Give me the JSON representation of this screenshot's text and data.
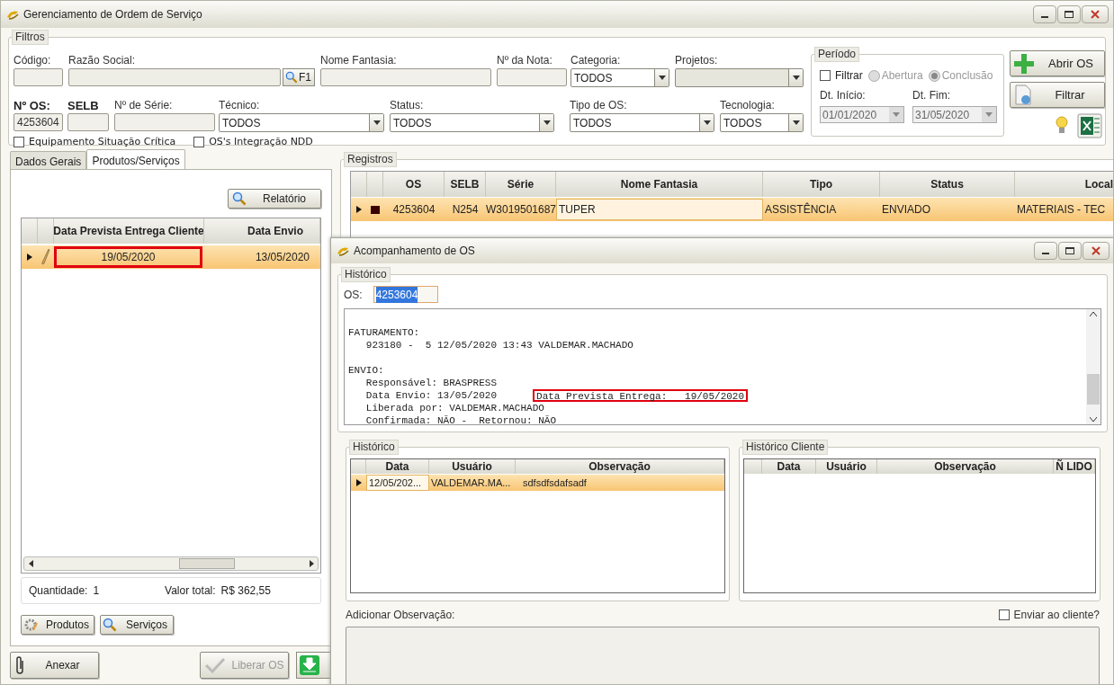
{
  "window": {
    "title": "Gerenciamento de Ordem de Serviço"
  },
  "filters": {
    "title": "Filtros",
    "row_1": [
      {
        "kind": "text",
        "label": "Código:"
      },
      {
        "kind": "lookup",
        "label": "Razão Social:",
        "button": "F1"
      },
      {
        "kind": "text",
        "label": "Nome Fantasia:"
      },
      {
        "kind": "text",
        "label": "Nº da Nota:"
      },
      {
        "kind": "combo",
        "label": "Categoria:",
        "value": "TODOS"
      },
      {
        "kind": "combo",
        "label": "Projetos:",
        "disabled": true
      }
    ],
    "row_2": [
      {
        "kind": "text",
        "label": "Nº OS:",
        "emphasized": true,
        "value": "4253604"
      },
      {
        "kind": "text",
        "label": "SELB",
        "emphasized": true
      },
      {
        "kind": "text",
        "label": "Nº de Série:"
      },
      {
        "kind": "combo",
        "label": "Técnico:",
        "value": "TODOS"
      },
      {
        "kind": "combo",
        "label": "Status:",
        "value": "TODOS"
      },
      {
        "kind": "combo",
        "label": "Tipo de OS:",
        "value": "TODOS"
      },
      {
        "kind": "combo",
        "label": "Tecnologia:",
        "value": "TODOS"
      }
    ],
    "checkboxes": [
      {
        "label": "Equipamento Situação Crítica",
        "checked": false
      },
      {
        "label": "OS's Integração NDD",
        "checked": false
      }
    ],
    "period": {
      "title": "Período",
      "filter": {
        "label": "Filtrar",
        "checked": false
      },
      "radios": [
        {
          "label": "Abertura",
          "selected": false,
          "disabled": true
        },
        {
          "label": "Conclusão",
          "selected": true,
          "disabled": true
        }
      ],
      "start": {
        "label": "Dt. Início:",
        "value": "01/01/2020"
      },
      "end": {
        "label": "Dt. Fim:",
        "value": "31/05/2020"
      }
    },
    "buttons": [
      "Abrir OS",
      "Filtrar"
    ]
  },
  "left_panel": {
    "tabs": [
      {
        "label": "Dados Gerais",
        "selected": false
      },
      {
        "label": "Produtos/Serviços",
        "selected": true
      }
    ],
    "report_button": "Relatório",
    "grid": {
      "columns": [
        "Data Prevista Entrega Cliente",
        "Data Envio"
      ],
      "rows": [
        {
          "selected": true,
          "cells": [
            {
              "text": "19/05/2020",
              "marked": true
            },
            {
              "text": "13/05/2020",
              "marked": false
            }
          ]
        }
      ]
    },
    "summary": [
      {
        "label": "Quantidade:",
        "value": "1"
      },
      {
        "label": "Valor total:",
        "value": "R$ 362,55"
      }
    ],
    "buttons": [
      "Produtos",
      "Serviços"
    ],
    "footer": [
      {
        "label": "Anexar",
        "disabled": false
      },
      {
        "label": "Liberar OS",
        "disabled": true
      }
    ]
  },
  "records": {
    "title": "Registros",
    "columns": [
      "OS",
      "SELB",
      "Série",
      "Nome Fantasia",
      "Tipo",
      "Status",
      "Local"
    ],
    "rows": [
      {
        "selected": true,
        "color": "#3a0000",
        "cells": [
          "4253604",
          "N254",
          "W3019501687",
          "TUPER",
          "ASSISTÊNCIA",
          "ENVIADO",
          "MATERIAIS - TEC"
        ]
      }
    ]
  },
  "dialog": {
    "title": "Acompanhamento de OS",
    "group": "Histórico",
    "os_label": "OS:",
    "os_value": "4253604",
    "log": [
      {
        "kind": "blank"
      },
      {
        "kind": "line",
        "text": "FATURAMENTO:"
      },
      {
        "kind": "line",
        "text": "   923180 -  5 12/05/2020 13:43 VALDEMAR.MACHADO"
      },
      {
        "kind": "blank"
      },
      {
        "kind": "line",
        "text": "ENVIO:"
      },
      {
        "kind": "line",
        "text": "   Responsável: BRASPRESS"
      },
      {
        "kind": "line",
        "text": "   Data Envio: 13/05/2020",
        "boxed": "Data Prevista Entrega:   19/05/2020"
      },
      {
        "kind": "line",
        "text": "   Liberada por: VALDEMAR.MACHADO"
      },
      {
        "kind": "line",
        "text": "   Confirmada: NÃO -  Retornou: NÃO"
      }
    ],
    "history": {
      "title": "Histórico",
      "columns": [
        "Data",
        "Usuário",
        "Observação"
      ],
      "rows": [
        {
          "selected": true,
          "cells": [
            "12/05/202...",
            "VALDEMAR.MA...",
            "sdfsdfsdafsadf"
          ]
        }
      ]
    },
    "client_history": {
      "title": "Histórico Cliente",
      "columns": [
        "Data",
        "Usuário",
        "Observação",
        "Ñ LIDO"
      ]
    },
    "add_note": {
      "label": "Adicionar Observação:",
      "send": {
        "label": "Enviar ao cliente?",
        "checked": false
      }
    }
  }
}
